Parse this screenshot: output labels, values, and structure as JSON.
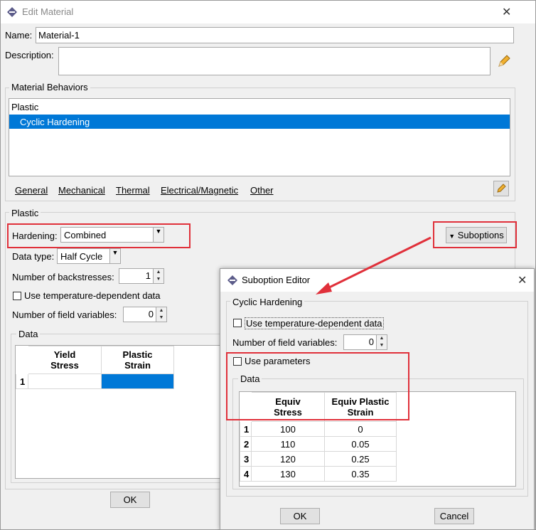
{
  "edit_material": {
    "title": "Edit Material",
    "name_label": "Name:",
    "name_value": "Material-1",
    "description_label": "Description:",
    "description_value": "",
    "behaviors_group": "Material Behaviors",
    "behaviors": [
      "Plastic",
      "Cyclic Hardening"
    ],
    "menus": [
      "General",
      "Mechanical",
      "Thermal",
      "Electrical/Magnetic",
      "Other"
    ],
    "plastic_group": "Plastic",
    "hardening_label": "Hardening:",
    "hardening_value": "Combined",
    "suboptions_label": "Suboptions",
    "datatype_label": "Data type:",
    "datatype_value": "Half Cycle",
    "backstresses_label": "Number of backstresses:",
    "backstresses_value": "1",
    "temp_dep_label": "Use temperature-dependent data",
    "field_vars_label": "Number of field variables:",
    "field_vars_value": "0",
    "data_group": "Data",
    "table_headers": [
      [
        "Yield",
        "Stress"
      ],
      [
        "Plastic",
        "Strain"
      ]
    ],
    "table_rows": [
      {
        "n": "1",
        "cells": [
          "",
          ""
        ]
      }
    ],
    "ok_label": "OK"
  },
  "suboption_editor": {
    "title": "Suboption Editor",
    "group": "Cyclic Hardening",
    "temp_dep_label": "Use temperature-dependent data",
    "field_vars_label": "Number of field variables:",
    "field_vars_value": "0",
    "use_params_label": "Use parameters",
    "data_group": "Data",
    "table_headers": [
      [
        "Equiv",
        "Stress"
      ],
      [
        "Equiv Plastic",
        "Strain"
      ]
    ],
    "table_rows": [
      {
        "n": "1",
        "cells": [
          "100",
          "0"
        ]
      },
      {
        "n": "2",
        "cells": [
          "110",
          "0.05"
        ]
      },
      {
        "n": "3",
        "cells": [
          "120",
          "0.25"
        ]
      },
      {
        "n": "4",
        "cells": [
          "130",
          "0.35"
        ]
      }
    ],
    "ok_label": "OK",
    "cancel_label": "Cancel"
  },
  "colors": {
    "selection": "#0078d7",
    "annotation": "#e0303a"
  }
}
